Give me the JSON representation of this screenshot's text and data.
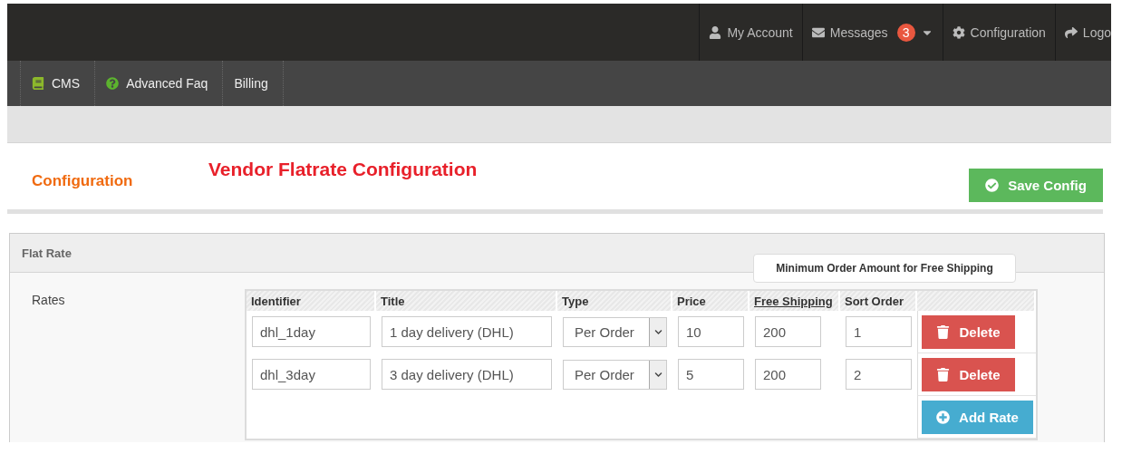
{
  "top_nav": [
    {
      "kind": "account",
      "label": "My Account"
    },
    {
      "kind": "messages",
      "label": "Messages",
      "badge": "3"
    },
    {
      "kind": "config",
      "label": "Configuration"
    },
    {
      "kind": "logout",
      "label": "Logo"
    }
  ],
  "menu": [
    {
      "kind": "cms",
      "label": "CMS"
    },
    {
      "kind": "faq",
      "label": "Advanced Faq"
    },
    {
      "kind": "plain",
      "label": "Billing"
    }
  ],
  "sidebar_heading": "Configuration",
  "page_title": "Vendor Flatrate Configuration",
  "save_button": "Save Config",
  "panel": {
    "title": "Flat Rate",
    "field_label": "Rates",
    "tooltip": "Minimum Order Amount for Free Shipping",
    "columns": [
      {
        "label": "Identifier",
        "kind": "plain"
      },
      {
        "label": "Title",
        "kind": "plain"
      },
      {
        "label": "Type",
        "kind": "plain"
      },
      {
        "label": "Price",
        "kind": "plain"
      },
      {
        "label": "Free Shipping",
        "kind": "help"
      },
      {
        "label": "Sort Order",
        "kind": "plain"
      }
    ],
    "rows": [
      {
        "identifier": "dhl_1day",
        "title": "1 day delivery (DHL)",
        "type": "Per Order",
        "price": "10",
        "free_shipping": "200",
        "sort_order": "1",
        "delete": "Delete"
      },
      {
        "identifier": "dhl_3day",
        "title": "3 day delivery (DHL)",
        "type": "Per Order",
        "price": "5",
        "free_shipping": "200",
        "sort_order": "2",
        "delete": "Delete"
      }
    ],
    "add_button": "Add Rate"
  }
}
